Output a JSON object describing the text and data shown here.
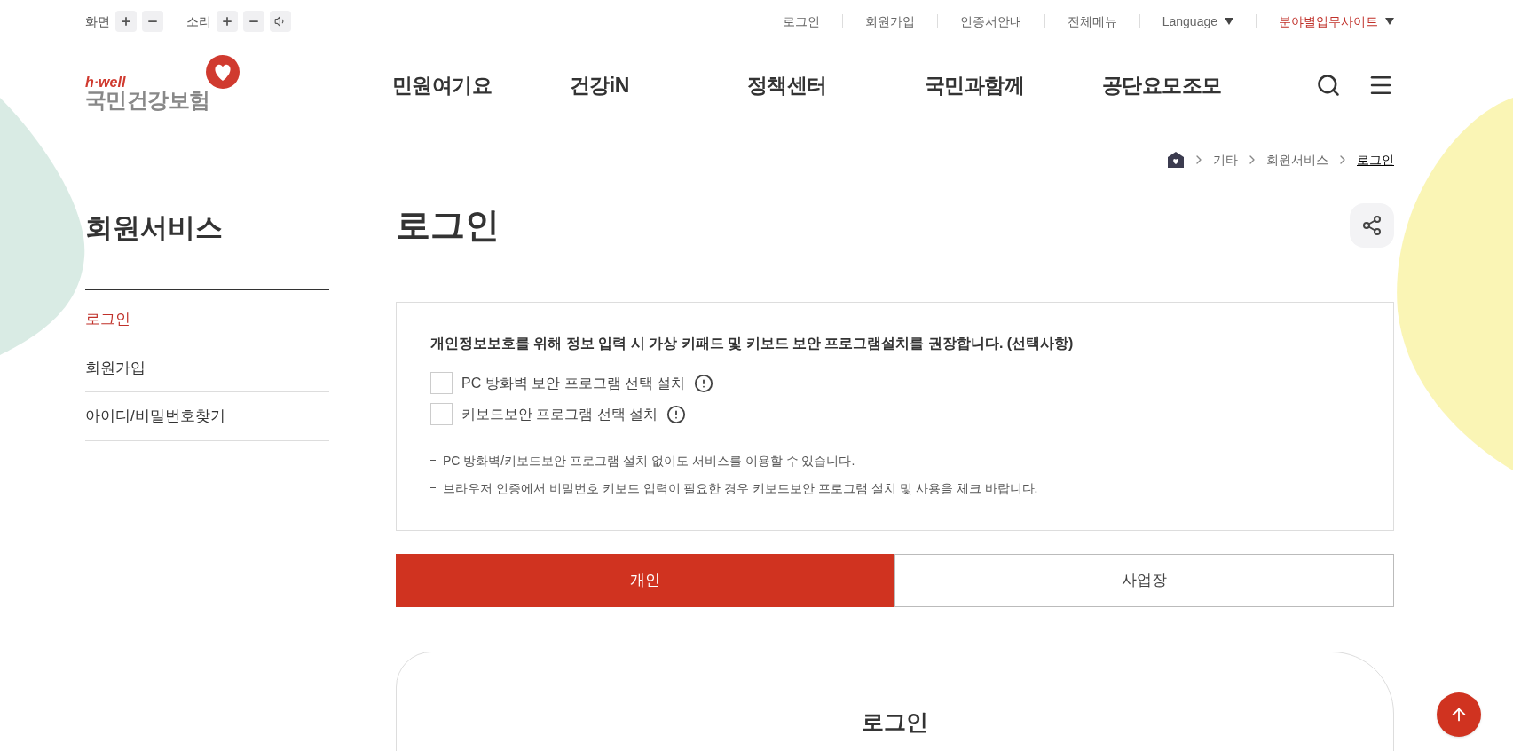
{
  "accessibility": {
    "screen_label": "화면",
    "sound_label": "소리"
  },
  "utility_links": [
    {
      "label": "로그인",
      "kind": "link",
      "highlighted": false
    },
    {
      "label": "회원가입",
      "kind": "link",
      "highlighted": false
    },
    {
      "label": "인증서안내",
      "kind": "link",
      "highlighted": false
    },
    {
      "label": "전체메뉴",
      "kind": "link",
      "highlighted": false
    },
    {
      "label": "Language",
      "kind": "dropdown",
      "highlighted": false
    },
    {
      "label": "분야별업무사이트",
      "kind": "dropdown",
      "highlighted": true
    }
  ],
  "logo": {
    "tagline": "h·well",
    "name": "국민건강보험"
  },
  "nav": [
    "민원여기요",
    "건강iN",
    "정책센터",
    "국민과함께",
    "공단요모조모"
  ],
  "breadcrumb": [
    {
      "label": "기타",
      "current": false
    },
    {
      "label": "회원서비스",
      "current": false
    },
    {
      "label": "로그인",
      "current": true
    }
  ],
  "sidebar": {
    "title": "회원서비스",
    "items": [
      {
        "label": "로그인",
        "selected": true
      },
      {
        "label": "회원가입",
        "selected": false
      },
      {
        "label": "아이디/비밀번호찾기",
        "selected": false
      }
    ]
  },
  "page_title": "로그인",
  "notice": {
    "heading": "개인정보보호를 위해 정보 입력 시 가상 키패드 및 키보드 보안 프로그램설치를 권장합니다. (선택사항)",
    "options": [
      {
        "label": "PC 방화벽 보안 프로그램 선택 설치",
        "checked": false
      },
      {
        "label": "키보드보안 프로그램 선택 설치",
        "checked": false
      }
    ],
    "notes": [
      "PC 방화벽/키보드보안 프로그램 설치 없이도 서비스를 이용할 수 있습니다.",
      "브라우저 인증에서 비밀번호 키보드 입력이 필요한 경우 키보드보안 프로그램 설치 및 사용을 체크 바랍니다."
    ]
  },
  "tabs": [
    {
      "label": "개인",
      "selected": true
    },
    {
      "label": "사업장",
      "selected": false
    }
  ],
  "login_card": {
    "title": "로그인"
  }
}
